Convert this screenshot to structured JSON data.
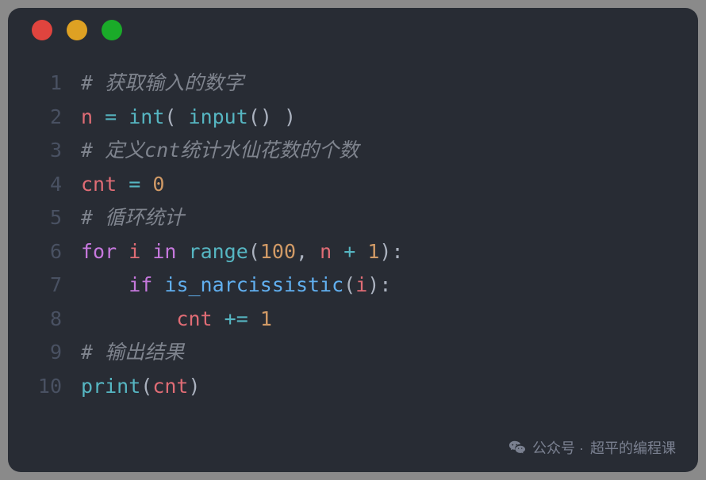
{
  "traffic_lights": [
    "red",
    "yellow",
    "green"
  ],
  "code": {
    "lines": [
      {
        "num": "1",
        "tokens": [
          {
            "cls": "tk-comment",
            "t": "# 获取输入的数字"
          }
        ]
      },
      {
        "num": "2",
        "tokens": [
          {
            "cls": "tk-var",
            "t": "n"
          },
          {
            "cls": "tk-punct",
            "t": " "
          },
          {
            "cls": "tk-op",
            "t": "="
          },
          {
            "cls": "tk-punct",
            "t": " "
          },
          {
            "cls": "tk-builtin",
            "t": "int"
          },
          {
            "cls": "tk-paren",
            "t": "( "
          },
          {
            "cls": "tk-builtin",
            "t": "input"
          },
          {
            "cls": "tk-paren",
            "t": "()"
          },
          {
            "cls": "tk-paren",
            "t": " )"
          }
        ]
      },
      {
        "num": "3",
        "tokens": [
          {
            "cls": "tk-comment",
            "t": "# 定义cnt统计水仙花数的个数"
          }
        ]
      },
      {
        "num": "4",
        "tokens": [
          {
            "cls": "tk-var",
            "t": "cnt"
          },
          {
            "cls": "tk-punct",
            "t": " "
          },
          {
            "cls": "tk-op",
            "t": "="
          },
          {
            "cls": "tk-punct",
            "t": " "
          },
          {
            "cls": "tk-num",
            "t": "0"
          }
        ]
      },
      {
        "num": "5",
        "tokens": [
          {
            "cls": "tk-comment",
            "t": "# 循环统计"
          }
        ]
      },
      {
        "num": "6",
        "tokens": [
          {
            "cls": "tk-keyword",
            "t": "for"
          },
          {
            "cls": "tk-punct",
            "t": " "
          },
          {
            "cls": "tk-var",
            "t": "i"
          },
          {
            "cls": "tk-punct",
            "t": " "
          },
          {
            "cls": "tk-keyword",
            "t": "in"
          },
          {
            "cls": "tk-punct",
            "t": " "
          },
          {
            "cls": "tk-builtin",
            "t": "range"
          },
          {
            "cls": "tk-paren",
            "t": "("
          },
          {
            "cls": "tk-num",
            "t": "100"
          },
          {
            "cls": "tk-punct",
            "t": ", "
          },
          {
            "cls": "tk-var",
            "t": "n"
          },
          {
            "cls": "tk-punct",
            "t": " "
          },
          {
            "cls": "tk-op",
            "t": "+"
          },
          {
            "cls": "tk-punct",
            "t": " "
          },
          {
            "cls": "tk-num",
            "t": "1"
          },
          {
            "cls": "tk-paren",
            "t": ")"
          },
          {
            "cls": "tk-punct",
            "t": ":"
          }
        ]
      },
      {
        "num": "7",
        "tokens": [
          {
            "cls": "tk-punct",
            "t": "    "
          },
          {
            "cls": "tk-keyword",
            "t": "if"
          },
          {
            "cls": "tk-punct",
            "t": " "
          },
          {
            "cls": "tk-call",
            "t": "is_narcissistic"
          },
          {
            "cls": "tk-paren",
            "t": "("
          },
          {
            "cls": "tk-var",
            "t": "i"
          },
          {
            "cls": "tk-paren",
            "t": ")"
          },
          {
            "cls": "tk-punct",
            "t": ":"
          }
        ]
      },
      {
        "num": "8",
        "tokens": [
          {
            "cls": "tk-punct",
            "t": "        "
          },
          {
            "cls": "tk-var",
            "t": "cnt"
          },
          {
            "cls": "tk-punct",
            "t": " "
          },
          {
            "cls": "tk-op",
            "t": "+="
          },
          {
            "cls": "tk-punct",
            "t": " "
          },
          {
            "cls": "tk-num",
            "t": "1"
          }
        ]
      },
      {
        "num": "9",
        "tokens": [
          {
            "cls": "tk-comment",
            "t": "# 输出结果"
          }
        ]
      },
      {
        "num": "10",
        "tokens": [
          {
            "cls": "tk-builtin",
            "t": "print"
          },
          {
            "cls": "tk-paren",
            "t": "("
          },
          {
            "cls": "tk-var",
            "t": "cnt"
          },
          {
            "cls": "tk-paren",
            "t": ")"
          }
        ]
      }
    ]
  },
  "watermark": {
    "prefix": "公众号 · ",
    "name": "超平的编程课"
  }
}
